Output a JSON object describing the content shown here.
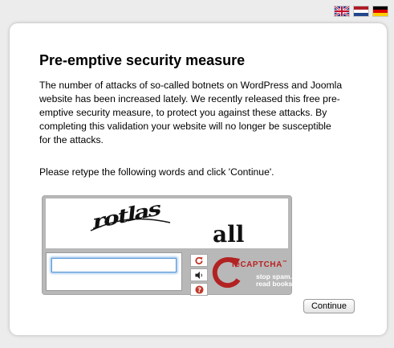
{
  "languages": [
    {
      "code": "en",
      "icon": "uk-flag-icon"
    },
    {
      "code": "nl",
      "icon": "nl-flag-icon"
    },
    {
      "code": "de",
      "icon": "de-flag-icon"
    }
  ],
  "dialog": {
    "title": "Pre-emptive security measure",
    "paragraph1": "The number of attacks of so-called botnets on WordPress and Joomla website has been increased lately. We recently released this free pre-emptive security measure, to protect you against these attacks. By completing this validation your website will no longer be susceptible for the attacks.",
    "paragraph2": "Please retype the following words and click 'Continue'.",
    "continue_label": "Continue"
  },
  "captcha": {
    "word1": "rotlas",
    "word2": "all",
    "input_value": "",
    "brand_prefix": "re",
    "brand_name": "CAPTCHA",
    "brand_tm": "™",
    "tagline_line1": "stop spam.",
    "tagline_line2": "read books.",
    "icons": [
      "refresh-icon",
      "audio-icon",
      "help-icon"
    ],
    "brand_color": "#b22222"
  }
}
